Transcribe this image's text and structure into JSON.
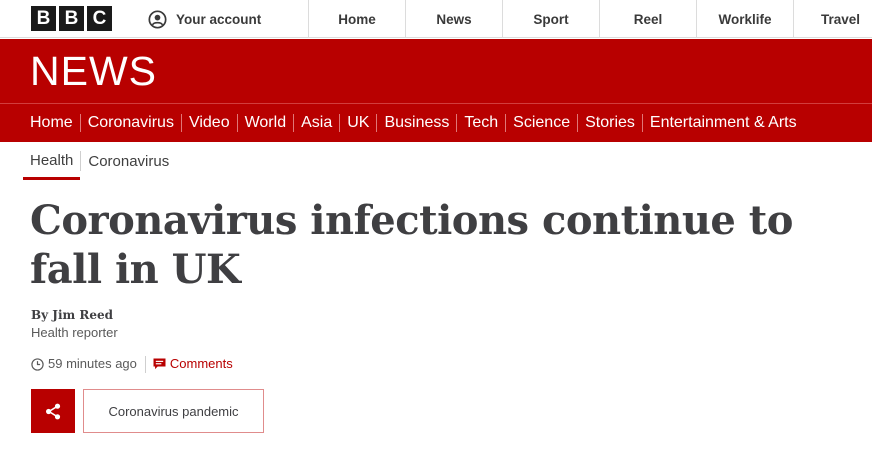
{
  "masthead": {
    "logo_letters": [
      "B",
      "B",
      "C"
    ],
    "account_label": "Your account",
    "account_icon": "user-circle-icon",
    "nav": [
      {
        "label": "Home"
      },
      {
        "label": "News"
      },
      {
        "label": "Sport"
      },
      {
        "label": "Reel"
      },
      {
        "label": "Worklife"
      },
      {
        "label": "Travel"
      }
    ]
  },
  "banner": {
    "wordmark": "NEWS",
    "background_color": "#b80000"
  },
  "section_nav": {
    "items": [
      {
        "label": "Home"
      },
      {
        "label": "Coronavirus"
      },
      {
        "label": "Video"
      },
      {
        "label": "World"
      },
      {
        "label": "Asia"
      },
      {
        "label": "UK"
      },
      {
        "label": "Business"
      },
      {
        "label": "Tech"
      },
      {
        "label": "Science"
      },
      {
        "label": "Stories"
      },
      {
        "label": "Entertainment & Arts"
      }
    ]
  },
  "breadcrumb": {
    "items": [
      {
        "label": "Health",
        "active": true
      },
      {
        "label": "Coronavirus",
        "active": false
      }
    ]
  },
  "article": {
    "headline": "Coronavirus infections continue to fall in UK",
    "author": "By Jim Reed",
    "author_role": "Health reporter",
    "timestamp": "59 minutes ago",
    "comments_label": "Comments",
    "share_icon": "share-icon",
    "tag_label": "Coronavirus pandemic"
  },
  "colors": {
    "accent": "#b80000",
    "headline_text": "#3f3f42",
    "muted_text": "#5a5a5a"
  }
}
